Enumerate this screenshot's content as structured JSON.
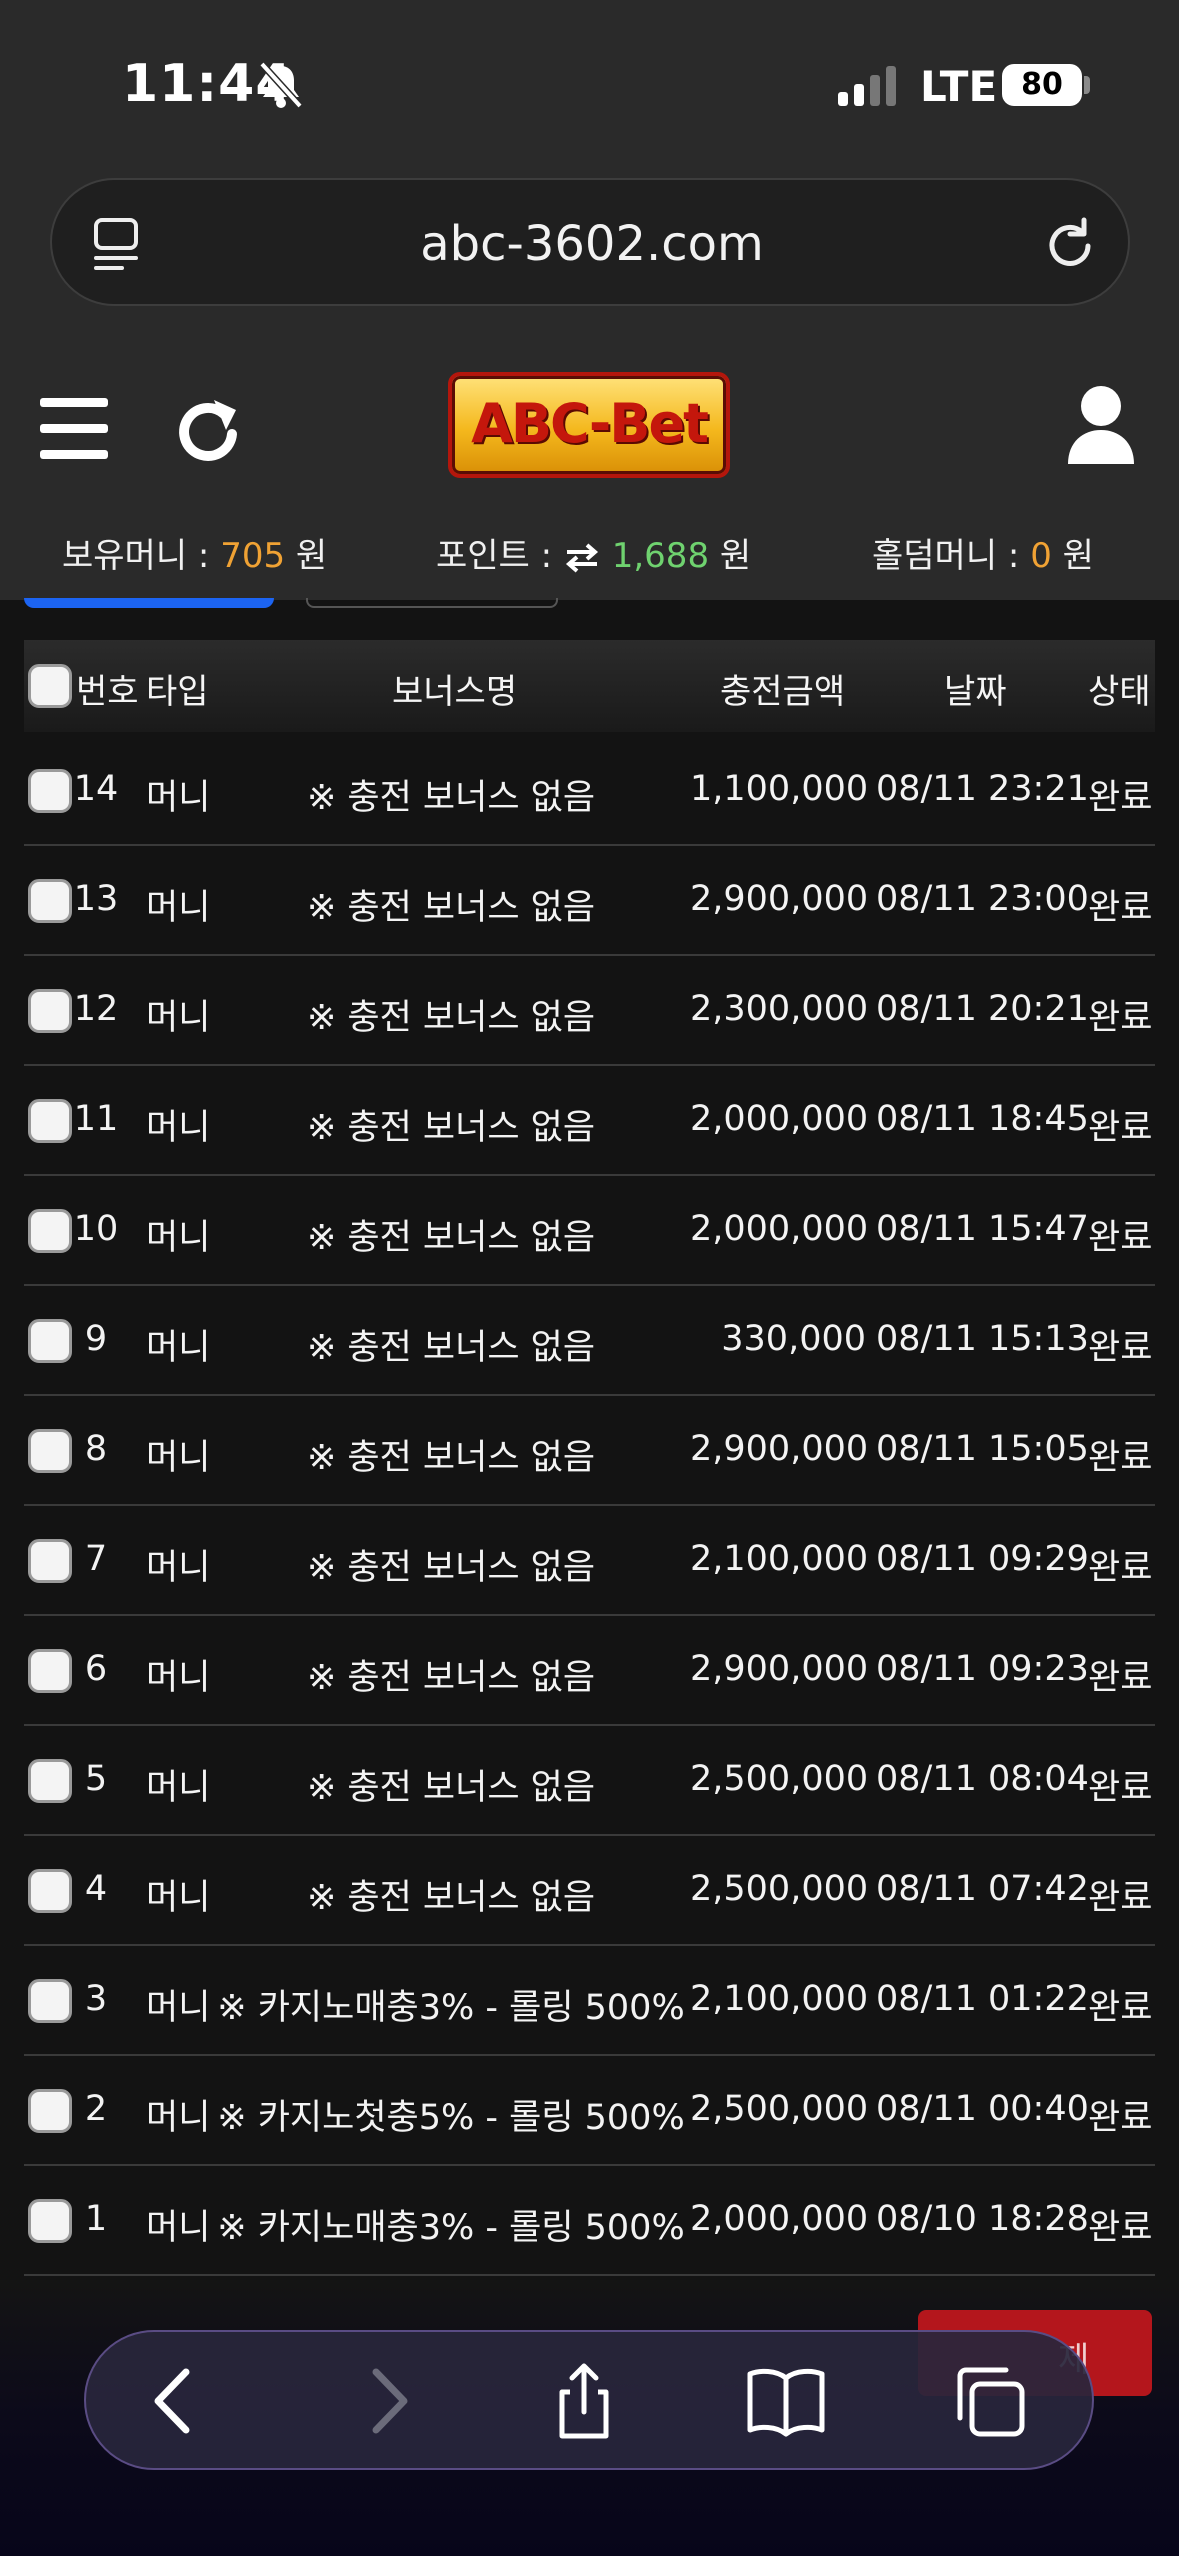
{
  "status": {
    "time": "11:44",
    "network": "LTE",
    "battery": "80"
  },
  "browser": {
    "url": "abc-3602.com"
  },
  "header": {
    "logo_text": "ABC-Bet"
  },
  "wallet": {
    "money_label": "보유머니 :",
    "money_value": "705",
    "money_unit": "원",
    "point_label": "포인트 :",
    "point_value": "1,688",
    "point_unit": "원",
    "holdem_label": "홀덤머니 :",
    "holdem_value": "0",
    "holdem_unit": "원"
  },
  "table": {
    "headers": {
      "no": "번호",
      "type": "타입",
      "bonus": "보너스명",
      "amount": "충전금액",
      "date": "날짜",
      "status": "상태"
    },
    "rows": [
      {
        "no": "14",
        "type": "머니",
        "bonus": "※ 충전 보너스 없음",
        "amount": "1,100,000",
        "date": "08/11 23:21",
        "status": "완료"
      },
      {
        "no": "13",
        "type": "머니",
        "bonus": "※ 충전 보너스 없음",
        "amount": "2,900,000",
        "date": "08/11 23:00",
        "status": "완료"
      },
      {
        "no": "12",
        "type": "머니",
        "bonus": "※ 충전 보너스 없음",
        "amount": "2,300,000",
        "date": "08/11 20:21",
        "status": "완료"
      },
      {
        "no": "11",
        "type": "머니",
        "bonus": "※ 충전 보너스 없음",
        "amount": "2,000,000",
        "date": "08/11 18:45",
        "status": "완료"
      },
      {
        "no": "10",
        "type": "머니",
        "bonus": "※ 충전 보너스 없음",
        "amount": "2,000,000",
        "date": "08/11 15:47",
        "status": "완료"
      },
      {
        "no": "9",
        "type": "머니",
        "bonus": "※ 충전 보너스 없음",
        "amount": "330,000",
        "date": "08/11 15:13",
        "status": "완료"
      },
      {
        "no": "8",
        "type": "머니",
        "bonus": "※ 충전 보너스 없음",
        "amount": "2,900,000",
        "date": "08/11 15:05",
        "status": "완료"
      },
      {
        "no": "7",
        "type": "머니",
        "bonus": "※ 충전 보너스 없음",
        "amount": "2,100,000",
        "date": "08/11 09:29",
        "status": "완료"
      },
      {
        "no": "6",
        "type": "머니",
        "bonus": "※ 충전 보너스 없음",
        "amount": "2,900,000",
        "date": "08/11 09:23",
        "status": "완료"
      },
      {
        "no": "5",
        "type": "머니",
        "bonus": "※ 충전 보너스 없음",
        "amount": "2,500,000",
        "date": "08/11 08:04",
        "status": "완료"
      },
      {
        "no": "4",
        "type": "머니",
        "bonus": "※ 충전 보너스 없음",
        "amount": "2,500,000",
        "date": "08/11 07:42",
        "status": "완료"
      },
      {
        "no": "3",
        "type": "머니",
        "bonus": "※ 카지노매충3% - 롤링 500%",
        "amount": "2,100,000",
        "date": "08/11 01:22",
        "status": "완료"
      },
      {
        "no": "2",
        "type": "머니",
        "bonus": "※ 카지노첫충5% - 롤링 500%",
        "amount": "2,500,000",
        "date": "08/11 00:40",
        "status": "완료"
      },
      {
        "no": "1",
        "type": "머니",
        "bonus": "※ 카지노매충3% - 롤링 500%",
        "amount": "2,000,000",
        "date": "08/10 18:28",
        "status": "완료"
      }
    ]
  },
  "footer": {
    "delete_label": "제"
  },
  "colors": {
    "accent_orange": "#f0a234",
    "accent_green": "#6fd26f",
    "tab_blue": "#1c64f2",
    "delete_red": "#b4161c"
  }
}
